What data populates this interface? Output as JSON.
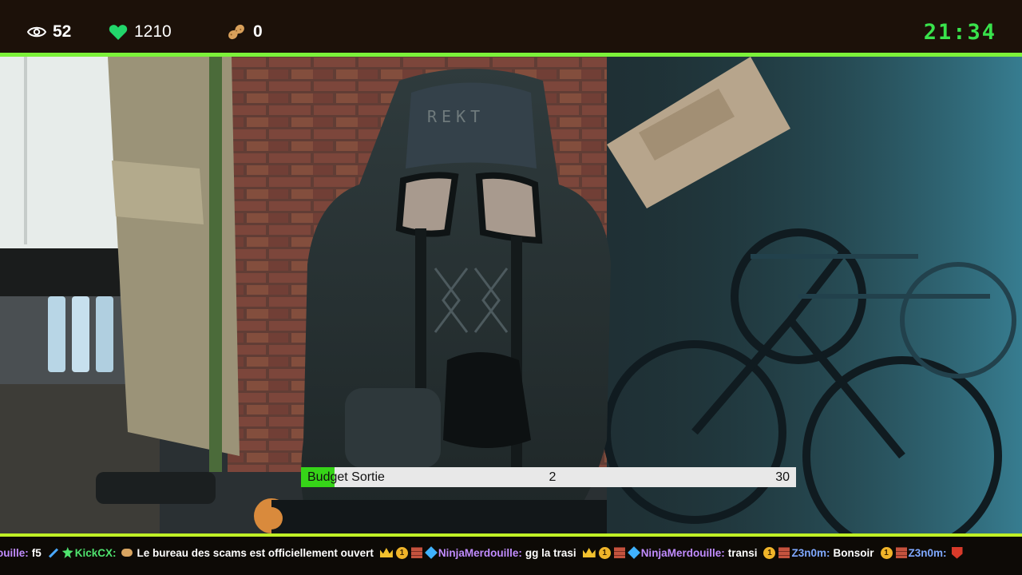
{
  "stats": {
    "viewers": "52",
    "hearts": "1210",
    "peanuts": "0"
  },
  "clock": "21:34",
  "scene": {
    "chair_brand": "REKT"
  },
  "budget": {
    "label": "Budget Sortie",
    "current": "2",
    "max": "30",
    "fraction": 0.067
  },
  "chat": [
    {
      "user": "ouille:",
      "message": "f5"
    },
    {
      "user": "KickCX:",
      "message": "Le bureau des scams est officiellement ouvert"
    },
    {
      "user": "NinjaMerdouille:",
      "message": "gg la trasi"
    },
    {
      "user": "NinjaMerdouille:",
      "message": "transi"
    },
    {
      "user": "Z3n0m:",
      "message": "Bonsoir"
    },
    {
      "user": "Z3n0m:",
      "message": ""
    }
  ],
  "colors": {
    "accent": "#7cf23a",
    "clock": "#39e34c",
    "budget_fill": "#36d418",
    "topbar": "#1c1109"
  }
}
